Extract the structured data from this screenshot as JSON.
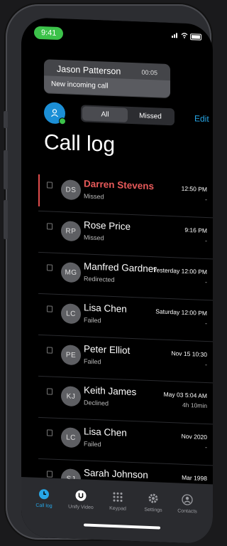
{
  "status": {
    "time": "9:41"
  },
  "banner": {
    "name": "Jason Patterson",
    "duration": "00:05",
    "message": "New incoming call"
  },
  "filter": {
    "all": "All",
    "missed": "Missed",
    "edit": "Edit"
  },
  "page_title": "Call log",
  "calls": [
    {
      "initials": "DS",
      "name": "Darren Stevens",
      "status": "Missed",
      "time": "12:50 PM",
      "duration": "-",
      "highlight": true
    },
    {
      "initials": "RP",
      "name": "Rose Price",
      "status": "Missed",
      "time": "9:16 PM",
      "duration": "-"
    },
    {
      "initials": "MG",
      "name": "Manfred Gardner",
      "status": "Redirected",
      "time": "Yesterday 12:00 PM",
      "duration": "-"
    },
    {
      "initials": "LC",
      "name": "Lisa Chen",
      "status": "Failed",
      "time": "Saturday 12:00 PM",
      "duration": "-"
    },
    {
      "initials": "PE",
      "name": "Peter Elliot",
      "status": "Failed",
      "time": "Nov 15 10:30",
      "duration": "-"
    },
    {
      "initials": "KJ",
      "name": "Keith James",
      "status": "Declined",
      "time": "May 03 5:04 AM",
      "duration": "4h 10min"
    },
    {
      "initials": "LC",
      "name": "Lisa Chen",
      "status": "Failed",
      "time": "Nov 2020",
      "duration": "-"
    },
    {
      "initials": "SJ",
      "name": "Sarah Johnson",
      "status": "",
      "time": "Mar 1998",
      "duration": "-"
    }
  ],
  "tabs": [
    {
      "label": "Call log",
      "icon": "clock-icon",
      "active": true
    },
    {
      "label": "Unify Video",
      "icon": "unify-video-icon"
    },
    {
      "label": "Keypad",
      "icon": "keypad-icon"
    },
    {
      "label": "Settings",
      "icon": "gear-icon"
    },
    {
      "label": "Contacts",
      "icon": "contacts-icon"
    }
  ],
  "colors": {
    "accent": "#27a6e6",
    "missed": "#e85a5a",
    "online": "#3cc24a"
  }
}
